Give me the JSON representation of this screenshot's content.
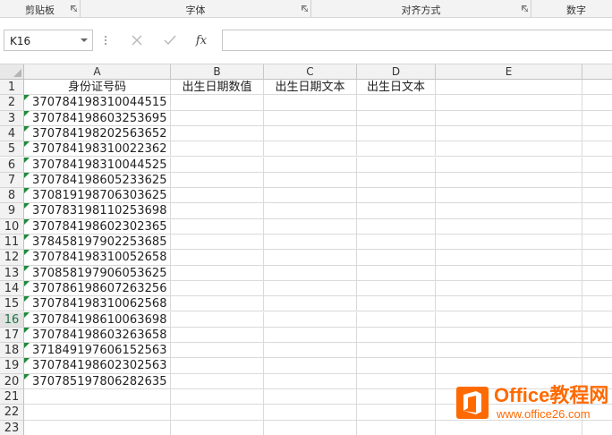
{
  "ribbon": {
    "groups": [
      {
        "label": "剪贴板",
        "launcher": true
      },
      {
        "label": "字体",
        "launcher": true
      },
      {
        "label": "对齐方式",
        "launcher": true
      },
      {
        "label": "数字",
        "launcher": false
      }
    ]
  },
  "formula_bar": {
    "name_box": "K16",
    "cancel_icon": "close-icon",
    "enter_icon": "check-icon",
    "function_label": "fx",
    "formula_value": ""
  },
  "sheet": {
    "columns": [
      "A",
      "B",
      "C",
      "D",
      "E"
    ],
    "active_row": 16,
    "row_numbers": [
      "1",
      "2",
      "3",
      "4",
      "5",
      "6",
      "7",
      "8",
      "9",
      "10",
      "11",
      "12",
      "13",
      "14",
      "15",
      "16",
      "17",
      "18",
      "19",
      "20",
      "21",
      "22",
      "23"
    ],
    "headers": {
      "A": "身份证号码",
      "B": "出生日期数值",
      "C": "出生日期文本",
      "D": "出生日文本"
    },
    "id_numbers": [
      "370784198310044515",
      "370784198603253695",
      "370784198202563652",
      "370784198310022362",
      "370784198310044525",
      "370784198605233625",
      "370819198706303625",
      "370783198110253698",
      "370784198602302365",
      "378458197902253685",
      "370784198310052658",
      "370858197906053625",
      "370786198607263256",
      "370784198310062568",
      "370784198610063698",
      "370784198603263658",
      "371849197606152563",
      "370784198602302563",
      "370785197806282635"
    ]
  },
  "watermark": {
    "title": "Office教程网",
    "url": "www.office26.com",
    "icon": "office-logo-icon",
    "color": "#ff6a00"
  }
}
